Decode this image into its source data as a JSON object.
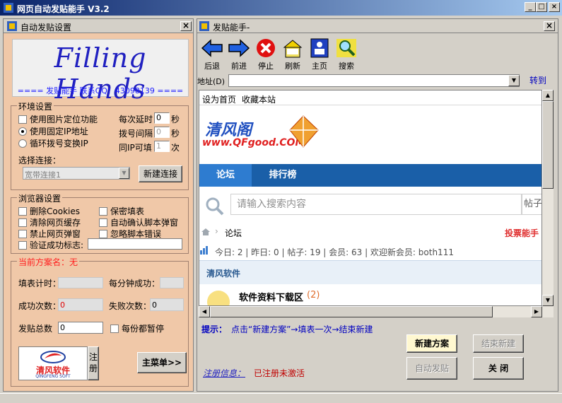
{
  "window": {
    "title": "网页自动发贴能手 V3.2",
    "min": "_",
    "max": "□",
    "close": "×"
  },
  "left": {
    "panel_title": "自动发贴设置",
    "close": "×",
    "banner_logo": "Filling Hands",
    "banner_sub": "==== 发贴能手 联系QQ：43098139 ====",
    "env": {
      "title": "环境设置",
      "opt_image_locate": "使用图片定位功能",
      "opt_fixed_ip": "使用固定IP地址",
      "opt_cycle_ip": "循环拨号变换IP",
      "delay_label": "每次延时",
      "delay_value": "0",
      "delay_unit": "秒",
      "dial_label": "拨号间隔",
      "dial_value": "0",
      "dial_unit": "秒",
      "sameip_label": "同IP可填",
      "sameip_value": "1",
      "sameip_unit": "次",
      "conn_label": "选择连接：",
      "conn_value": "宽带连接1",
      "new_conn_button": "新建连接"
    },
    "browser_settings": {
      "title": "浏览器设置",
      "delete_cookies": "删除Cookies",
      "clear_cache": "清除网页缓存",
      "block_popup": "禁止网页弹窗",
      "verify_flag": "验证成功标志:",
      "secret_fill": "保密填表",
      "auto_confirm": "自动确认脚本弹窗",
      "ignore_errors": "忽略脚本错误"
    },
    "plan": {
      "current_label": "当前方案名：无",
      "timer_label": "填表计时：",
      "per_min_label": "每分钟成功：",
      "success_label": "成功次数：",
      "success_value": "0",
      "fail_label": "失败次数：",
      "fail_value": "0",
      "total_label": "发贴总数",
      "total_value": "0",
      "pause_label": "每份都暂停",
      "register_button": "注册",
      "main_menu_button": "主菜单>>",
      "logo_text": "清风软件",
      "logo_sub": "QINGFENG SOFT"
    }
  },
  "browser": {
    "panel_title": "发贴能手-",
    "close": "×",
    "toolbar": [
      {
        "label": "后退"
      },
      {
        "label": "前进"
      },
      {
        "label": "停止"
      },
      {
        "label": "刷新"
      },
      {
        "label": "主页"
      },
      {
        "label": "搜索"
      }
    ],
    "address_label": "地址(D)",
    "address_value": "",
    "go_label": "转到",
    "web": {
      "set_home": "设为首页",
      "favorite": "收藏本站",
      "site_logo_cn": "清风阁",
      "site_logo_url": "www.QFgood.COM",
      "nav_forum": "论坛",
      "nav_rank": "排行榜",
      "search_placeholder": "请输入搜索内容",
      "search_btn": "帖子",
      "breadcrumb": "论坛",
      "vote_link": "投票能手",
      "stats": "今日: 2 | 昨日: 0 | 帖子: 19 | 会员: 63 | 欢迎新会员: both111",
      "section": "清风软件",
      "board_name": "软件资料下载区",
      "board_count": "(2)"
    },
    "hint_label": "提示：",
    "hint_text": "点击“新建方案”→填表一次→结束新建",
    "new_plan_button": "新建方案",
    "end_new_button": "结束新建",
    "auto_post_button": "自动发贴",
    "close_button": "关 闭",
    "reg_info_label": "注册信息：",
    "reg_info_value": "已注册未激活"
  },
  "colors": {
    "accent": "#0a246a",
    "panel": "#f0c8a8",
    "nav_blue": "#1a5fa8",
    "link_blue": "#0000ff"
  }
}
